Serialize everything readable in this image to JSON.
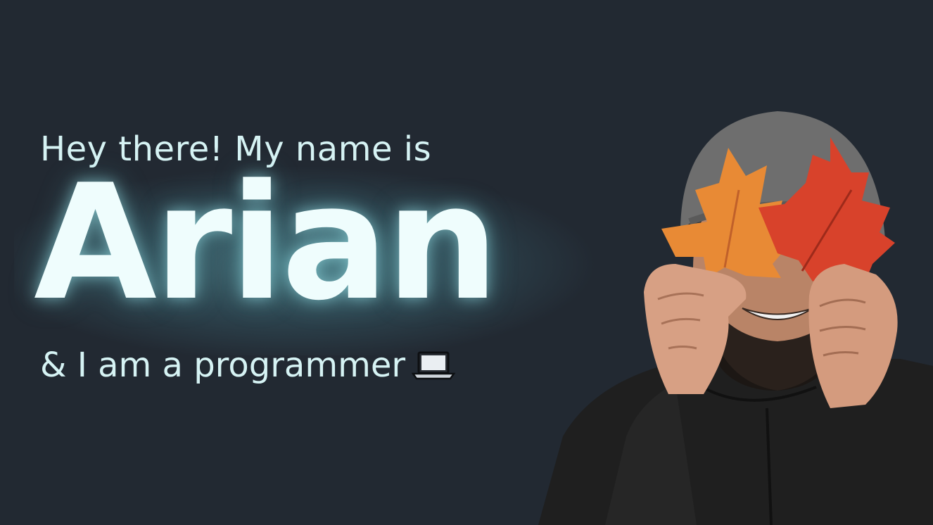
{
  "hero": {
    "intro": "Hey there! My name is",
    "name": "Arian",
    "tagline": "& I am a programmer"
  },
  "icons": {
    "tagline_icon": "laptop-icon"
  },
  "colors": {
    "background": "#222932",
    "text": "#d6f3f4",
    "name": "#effdfd",
    "glow": "#5fa5af"
  }
}
